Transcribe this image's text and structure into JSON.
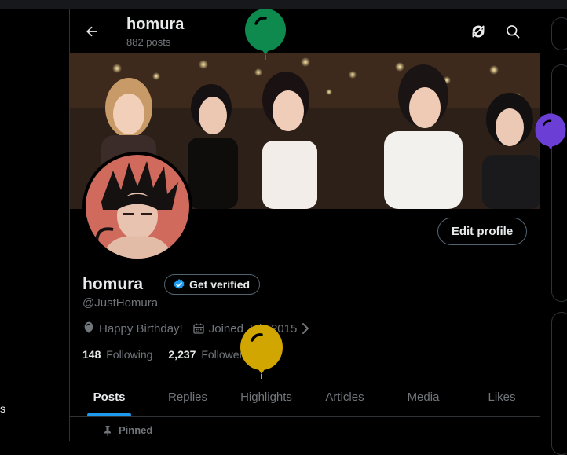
{
  "header": {
    "title": "homura",
    "post_count": "882 posts",
    "icons": [
      "back-arrow-icon",
      "sync-icon",
      "search-icon"
    ]
  },
  "profile": {
    "name": "homura",
    "verify_label": "Get verified",
    "handle": "@JustHomura",
    "birthday": "Happy Birthday!",
    "joined": "Joined July 2015",
    "following_count": "148",
    "following_label": "Following",
    "followers_count": "2,237",
    "followers_label": "Followers",
    "edit_label": "Edit profile"
  },
  "tabs": [
    {
      "label": "Posts",
      "active": true
    },
    {
      "label": "Replies"
    },
    {
      "label": "Highlights"
    },
    {
      "label": "Articles"
    },
    {
      "label": "Media"
    },
    {
      "label": "Likes"
    }
  ],
  "pinned_label": "Pinned",
  "left_fragment": "s",
  "colors": {
    "accent": "#1d9bf0",
    "balloon_green": "#0f8a4f",
    "balloon_yellow": "#d1a600",
    "balloon_purple": "#6b3fd6"
  }
}
